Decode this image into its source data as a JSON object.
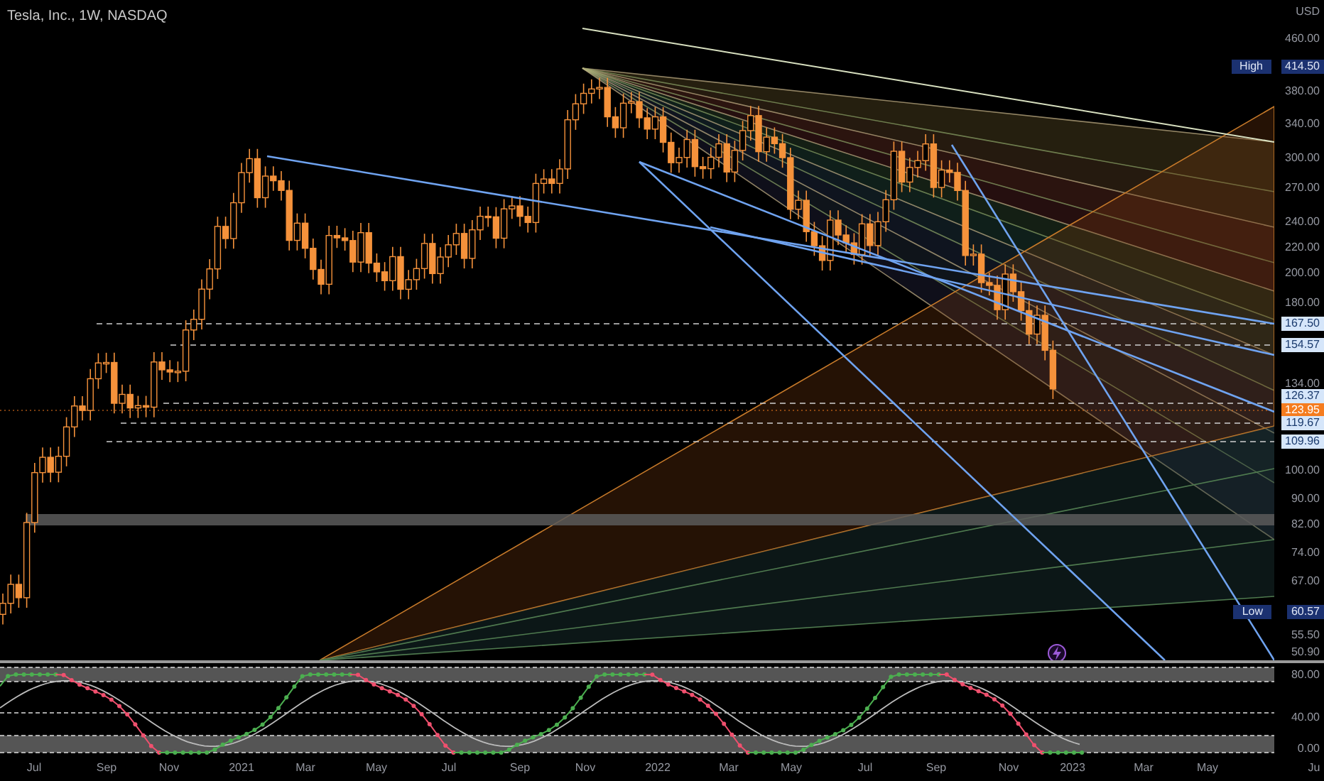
{
  "chart": {
    "title": "Tesla, Inc., 1W, NASDAQ"
  },
  "price_axis": {
    "currency": "USD",
    "ticks": [
      "460.00",
      "380.00",
      "340.00",
      "300.00",
      "270.00",
      "240.00",
      "220.00",
      "200.00",
      "180.00",
      "134.00",
      "100.00",
      "90.00",
      "82.00",
      "74.00",
      "67.00",
      "55.50",
      "50.90"
    ]
  },
  "price_markers": [
    {
      "kind": "extreme",
      "label": "High",
      "value": "414.50"
    },
    {
      "kind": "level",
      "value": "167.50"
    },
    {
      "kind": "level",
      "value": "154.57"
    },
    {
      "kind": "level",
      "value": "126.37"
    },
    {
      "kind": "current",
      "value": "123.95"
    },
    {
      "kind": "level",
      "value": "119.67"
    },
    {
      "kind": "level",
      "value": "109.96"
    },
    {
      "kind": "extreme",
      "label": "Low",
      "value": "60.57"
    }
  ],
  "oscillator_axis": {
    "ticks": [
      "80.00",
      "40.00",
      "0.00"
    ]
  },
  "time_axis": {
    "ticks": [
      "Jul",
      "Sep",
      "Nov",
      "2021",
      "Mar",
      "May",
      "Jul",
      "Sep",
      "Nov",
      "2022",
      "Mar",
      "May",
      "Jul",
      "Sep",
      "Nov",
      "2023",
      "Mar",
      "May",
      "Ju"
    ]
  }
}
